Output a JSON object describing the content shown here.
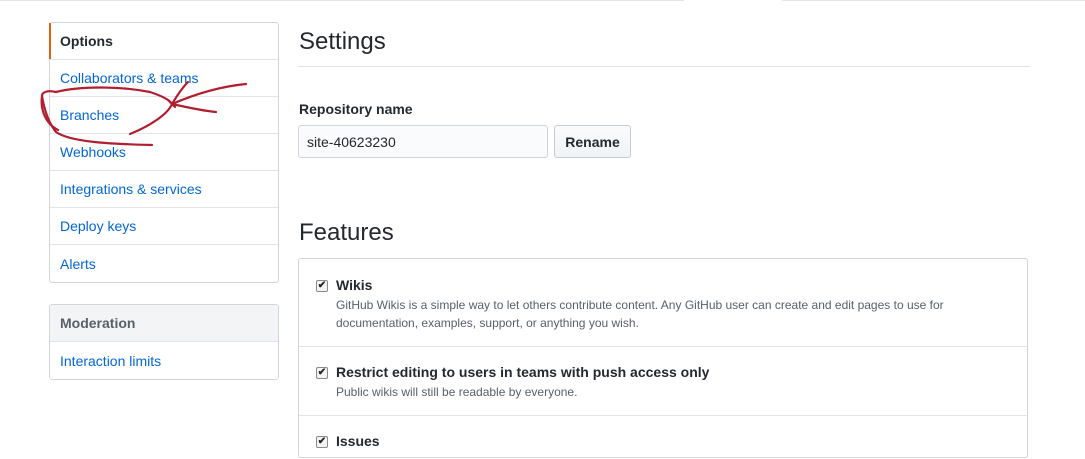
{
  "sidebar": {
    "items": [
      {
        "label": "Options"
      },
      {
        "label": "Collaborators & teams"
      },
      {
        "label": "Branches"
      },
      {
        "label": "Webhooks"
      },
      {
        "label": "Integrations & services"
      },
      {
        "label": "Deploy keys"
      },
      {
        "label": "Alerts"
      }
    ],
    "moderation": {
      "heading": "Moderation",
      "items": [
        {
          "label": "Interaction limits"
        }
      ]
    }
  },
  "main": {
    "title": "Settings",
    "repo": {
      "label": "Repository name",
      "value": "site-40623230",
      "rename_label": "Rename"
    },
    "features": {
      "title": "Features",
      "items": [
        {
          "name": "Wikis",
          "description": "GitHub Wikis is a simple way to let others contribute content. Any GitHub user can create and edit pages to use for documentation, examples, support, or anything you wish.",
          "checked": true
        },
        {
          "name": "Restrict editing to users in teams with push access only",
          "description": "Public wikis will still be readable by everyone.",
          "checked": true
        },
        {
          "name": "Issues",
          "checked": true
        }
      ]
    }
  },
  "icons": {
    "checkbox": "checkbox-checked-icon",
    "check_glyph": "✔"
  },
  "colors": {
    "link": "#0366d6",
    "selected_accent": "#e36209",
    "annotation": "#b01e2f"
  }
}
